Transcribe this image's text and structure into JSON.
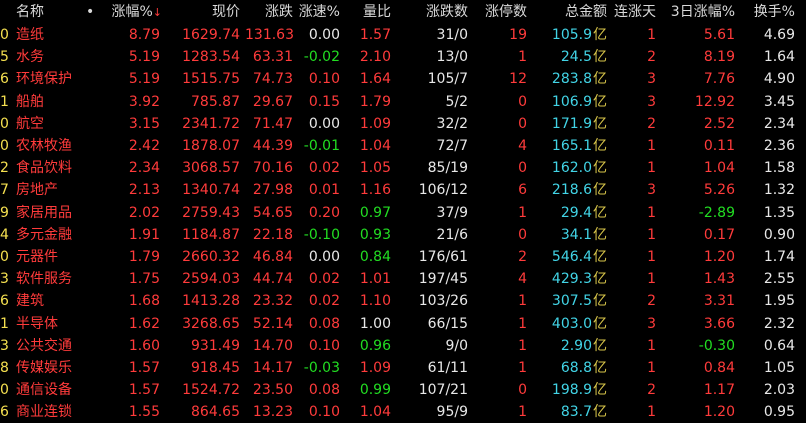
{
  "header": {
    "name": "名称",
    "dot": "•",
    "change_pct": "涨幅%",
    "sort_arrow": "↓",
    "price": "现价",
    "change": "涨跌",
    "speed": "涨速%",
    "volume_ratio": "量比",
    "up_down_count": "涨跌数",
    "limit_up_count": "涨停数",
    "total_amount": "总金额",
    "consecutive_days": "连涨天",
    "three_day_change": "3日涨幅%",
    "turnover": "换手%"
  },
  "colors": {
    "up": "#ff3b3b",
    "down": "#22dd22",
    "flat": "#e8e8e8",
    "amount": "#42d4e6",
    "index": "#f5e050"
  },
  "rows": [
    {
      "idx": "0",
      "name": "造纸",
      "change_pct": "8.79",
      "price": "1629.74",
      "change": "131.63",
      "speed": "0.00",
      "volume_ratio": "1.57",
      "up_down": "31/0",
      "limit_up": "19",
      "amount": "105.9",
      "unit": "亿",
      "consec": "1",
      "three_day": "5.61",
      "turnover": "4.69",
      "speed_dir": "flat",
      "vr_dir": "up",
      "three_dir": "up"
    },
    {
      "idx": "5",
      "name": "水务",
      "change_pct": "5.19",
      "price": "1283.54",
      "change": "63.31",
      "speed": "-0.02",
      "volume_ratio": "2.10",
      "up_down": "13/0",
      "limit_up": "1",
      "amount": "24.5",
      "unit": "亿",
      "consec": "2",
      "three_day": "8.19",
      "turnover": "1.64",
      "speed_dir": "down",
      "vr_dir": "up",
      "three_dir": "up"
    },
    {
      "idx": "6",
      "name": "环境保护",
      "change_pct": "5.19",
      "price": "1515.75",
      "change": "74.73",
      "speed": "0.10",
      "volume_ratio": "1.64",
      "up_down": "105/7",
      "limit_up": "12",
      "amount": "283.8",
      "unit": "亿",
      "consec": "3",
      "three_day": "7.76",
      "turnover": "4.90",
      "speed_dir": "up",
      "vr_dir": "up",
      "three_dir": "up"
    },
    {
      "idx": "1",
      "name": "船舶",
      "change_pct": "3.92",
      "price": "785.87",
      "change": "29.67",
      "speed": "0.15",
      "volume_ratio": "1.79",
      "up_down": "5/2",
      "limit_up": "0",
      "amount": "106.9",
      "unit": "亿",
      "consec": "3",
      "three_day": "12.92",
      "turnover": "3.45",
      "speed_dir": "up",
      "vr_dir": "up",
      "three_dir": "up"
    },
    {
      "idx": "0",
      "name": "航空",
      "change_pct": "3.15",
      "price": "2341.72",
      "change": "71.47",
      "speed": "0.00",
      "volume_ratio": "1.09",
      "up_down": "32/2",
      "limit_up": "0",
      "amount": "171.9",
      "unit": "亿",
      "consec": "2",
      "three_day": "2.52",
      "turnover": "2.34",
      "speed_dir": "flat",
      "vr_dir": "up",
      "three_dir": "up"
    },
    {
      "idx": "0",
      "name": "农林牧渔",
      "change_pct": "2.42",
      "price": "1878.07",
      "change": "44.39",
      "speed": "-0.01",
      "volume_ratio": "1.04",
      "up_down": "72/7",
      "limit_up": "4",
      "amount": "165.1",
      "unit": "亿",
      "consec": "1",
      "three_day": "0.11",
      "turnover": "2.36",
      "speed_dir": "down",
      "vr_dir": "up",
      "three_dir": "up"
    },
    {
      "idx": "2",
      "name": "食品饮料",
      "change_pct": "2.34",
      "price": "3068.57",
      "change": "70.16",
      "speed": "0.02",
      "volume_ratio": "1.05",
      "up_down": "85/19",
      "limit_up": "0",
      "amount": "162.0",
      "unit": "亿",
      "consec": "1",
      "three_day": "1.04",
      "turnover": "1.58",
      "speed_dir": "up",
      "vr_dir": "up",
      "three_dir": "up"
    },
    {
      "idx": "7",
      "name": "房地产",
      "change_pct": "2.13",
      "price": "1340.74",
      "change": "27.98",
      "speed": "0.01",
      "volume_ratio": "1.16",
      "up_down": "106/12",
      "limit_up": "6",
      "amount": "218.6",
      "unit": "亿",
      "consec": "3",
      "three_day": "5.26",
      "turnover": "1.32",
      "speed_dir": "up",
      "vr_dir": "up",
      "three_dir": "up"
    },
    {
      "idx": "9",
      "name": "家居用品",
      "change_pct": "2.02",
      "price": "2759.43",
      "change": "54.65",
      "speed": "0.20",
      "volume_ratio": "0.97",
      "up_down": "37/9",
      "limit_up": "1",
      "amount": "29.4",
      "unit": "亿",
      "consec": "1",
      "three_day": "-2.89",
      "turnover": "1.35",
      "speed_dir": "up",
      "vr_dir": "down",
      "three_dir": "down"
    },
    {
      "idx": "4",
      "name": "多元金融",
      "change_pct": "1.91",
      "price": "1184.87",
      "change": "22.18",
      "speed": "-0.10",
      "volume_ratio": "0.93",
      "up_down": "21/6",
      "limit_up": "0",
      "amount": "34.1",
      "unit": "亿",
      "consec": "1",
      "three_day": "0.17",
      "turnover": "0.90",
      "speed_dir": "down",
      "vr_dir": "down",
      "three_dir": "up"
    },
    {
      "idx": "0",
      "name": "元器件",
      "change_pct": "1.79",
      "price": "2660.32",
      "change": "46.84",
      "speed": "0.00",
      "volume_ratio": "0.84",
      "up_down": "176/61",
      "limit_up": "2",
      "amount": "546.4",
      "unit": "亿",
      "consec": "1",
      "three_day": "1.20",
      "turnover": "1.74",
      "speed_dir": "flat",
      "vr_dir": "down",
      "three_dir": "up"
    },
    {
      "idx": "3",
      "name": "软件服务",
      "change_pct": "1.75",
      "price": "2594.03",
      "change": "44.74",
      "speed": "0.02",
      "volume_ratio": "1.01",
      "up_down": "197/45",
      "limit_up": "4",
      "amount": "429.3",
      "unit": "亿",
      "consec": "1",
      "three_day": "1.43",
      "turnover": "2.55",
      "speed_dir": "up",
      "vr_dir": "up",
      "three_dir": "up"
    },
    {
      "idx": "6",
      "name": "建筑",
      "change_pct": "1.68",
      "price": "1413.28",
      "change": "23.32",
      "speed": "0.02",
      "volume_ratio": "1.10",
      "up_down": "103/26",
      "limit_up": "1",
      "amount": "307.5",
      "unit": "亿",
      "consec": "2",
      "three_day": "3.31",
      "turnover": "1.95",
      "speed_dir": "up",
      "vr_dir": "up",
      "three_dir": "up"
    },
    {
      "idx": "1",
      "name": "半导体",
      "change_pct": "1.62",
      "price": "3268.65",
      "change": "52.14",
      "speed": "0.08",
      "volume_ratio": "1.00",
      "up_down": "66/15",
      "limit_up": "1",
      "amount": "403.0",
      "unit": "亿",
      "consec": "3",
      "three_day": "3.66",
      "turnover": "2.32",
      "speed_dir": "up",
      "vr_dir": "flat",
      "three_dir": "up"
    },
    {
      "idx": "3",
      "name": "公共交通",
      "change_pct": "1.60",
      "price": "931.49",
      "change": "14.70",
      "speed": "0.10",
      "volume_ratio": "0.96",
      "up_down": "9/0",
      "limit_up": "1",
      "amount": "2.90",
      "unit": "亿",
      "consec": "1",
      "three_day": "-0.30",
      "turnover": "0.64",
      "speed_dir": "up",
      "vr_dir": "down",
      "three_dir": "down"
    },
    {
      "idx": "8",
      "name": "传媒娱乐",
      "change_pct": "1.57",
      "price": "918.45",
      "change": "14.17",
      "speed": "-0.03",
      "volume_ratio": "1.09",
      "up_down": "61/11",
      "limit_up": "1",
      "amount": "68.8",
      "unit": "亿",
      "consec": "1",
      "three_day": "0.84",
      "turnover": "1.05",
      "speed_dir": "down",
      "vr_dir": "up",
      "three_dir": "up"
    },
    {
      "idx": "0",
      "name": "通信设备",
      "change_pct": "1.57",
      "price": "1524.72",
      "change": "23.50",
      "speed": "0.08",
      "volume_ratio": "0.99",
      "up_down": "107/21",
      "limit_up": "0",
      "amount": "198.9",
      "unit": "亿",
      "consec": "2",
      "three_day": "1.17",
      "turnover": "2.03",
      "speed_dir": "up",
      "vr_dir": "down",
      "three_dir": "up"
    },
    {
      "idx": "6",
      "name": "商业连锁",
      "change_pct": "1.55",
      "price": "864.65",
      "change": "13.23",
      "speed": "0.10",
      "volume_ratio": "1.04",
      "up_down": "95/9",
      "limit_up": "1",
      "amount": "83.7",
      "unit": "亿",
      "consec": "1",
      "three_day": "1.20",
      "turnover": "0.95",
      "speed_dir": "up",
      "vr_dir": "up",
      "three_dir": "up"
    }
  ]
}
